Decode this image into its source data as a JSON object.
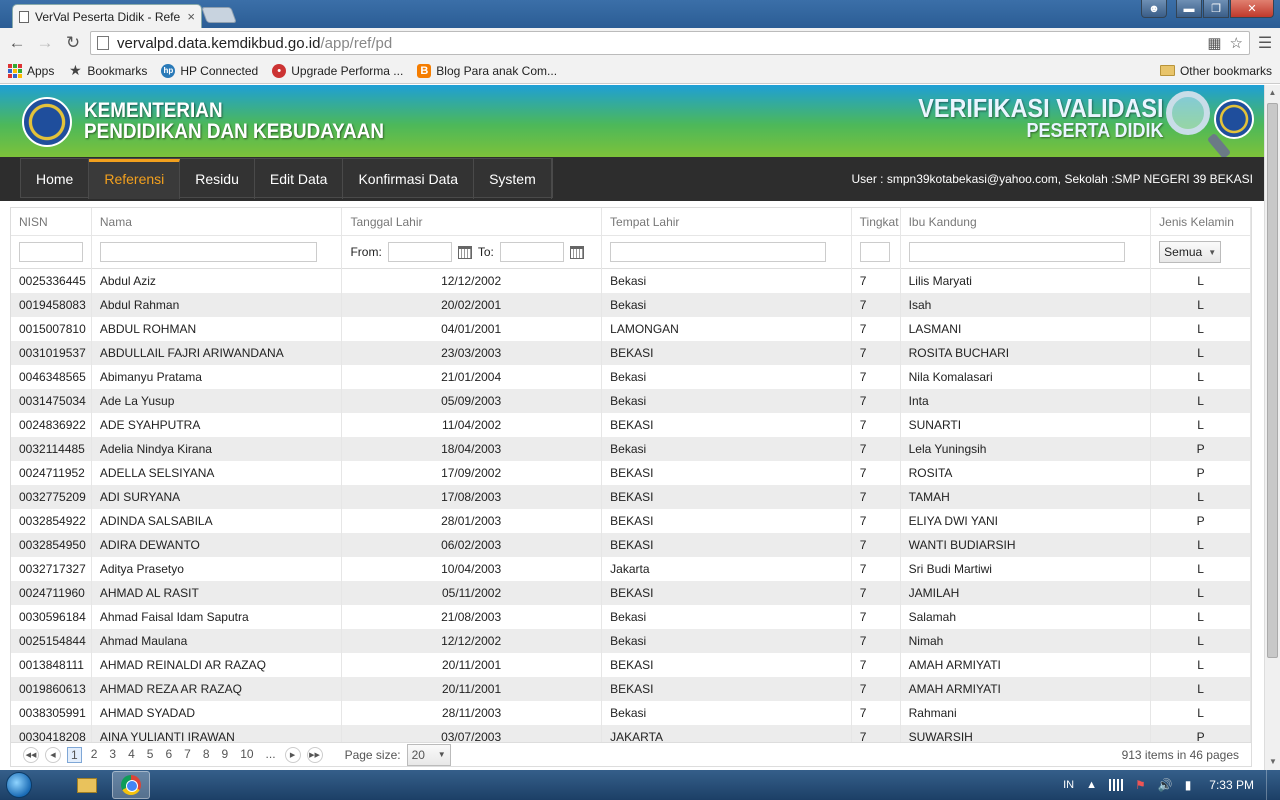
{
  "browser": {
    "tab_title": "VerVal Peserta Didik - Refe",
    "tab_close": "×",
    "url_host": "vervalpd.data.kemdikbud.go.id",
    "url_path": "/app/ref/pd",
    "bookmarks": [
      {
        "label": "Apps",
        "icon": "apps-icon"
      },
      {
        "label": "Bookmarks",
        "icon": "star-icon"
      },
      {
        "label": "HP Connected",
        "icon": "hp-icon"
      },
      {
        "label": "Upgrade Performa ...",
        "icon": "upgrade-icon"
      },
      {
        "label": "Blog Para anak Com...",
        "icon": "blogger-icon"
      }
    ],
    "other_bookmarks": "Other bookmarks"
  },
  "banner": {
    "left_line1": "KEMENTERIAN",
    "left_line2": "PENDIDIKAN DAN KEBUDAYAAN",
    "right_line1": "VERIFIKASI VALIDASI",
    "right_line2": "PESERTA DIDIK"
  },
  "nav": {
    "items": [
      "Home",
      "Referensi",
      "Residu",
      "Edit Data",
      "Konfirmasi Data",
      "System"
    ],
    "active": "Referensi",
    "user_info": "User : smpn39kotabekasi@yahoo.com, Sekolah :SMP NEGERI 39 BEKASI"
  },
  "grid": {
    "columns": [
      "NISN",
      "Nama",
      "Tanggal Lahir",
      "Tempat Lahir",
      "Tingkat",
      "Ibu Kandung",
      "Jenis Kelamin"
    ],
    "filter_from": "From:",
    "filter_to": "To:",
    "gender_filter": "Semua",
    "rows": [
      [
        "0025336445",
        "Abdul Aziz",
        "12/12/2002",
        "Bekasi",
        "7",
        "Lilis Maryati",
        "L"
      ],
      [
        "0019458083",
        "Abdul Rahman",
        "20/02/2001",
        "Bekasi",
        "7",
        "Isah",
        "L"
      ],
      [
        "0015007810",
        "ABDUL ROHMAN",
        "04/01/2001",
        "LAMONGAN",
        "7",
        "LASMANI",
        "L"
      ],
      [
        "0031019537",
        "ABDULLAIL FAJRI ARIWANDANA",
        "23/03/2003",
        "BEKASI",
        "7",
        "ROSITA BUCHARI",
        "L"
      ],
      [
        "0046348565",
        "Abimanyu Pratama",
        "21/01/2004",
        "Bekasi",
        "7",
        "Nila Komalasari",
        "L"
      ],
      [
        "0031475034",
        "Ade La Yusup",
        "05/09/2003",
        "Bekasi",
        "7",
        "Inta",
        "L"
      ],
      [
        "0024836922",
        "ADE SYAHPUTRA",
        "11/04/2002",
        "BEKASI",
        "7",
        "SUNARTI",
        "L"
      ],
      [
        "0032114485",
        "Adelia Nindya Kirana",
        "18/04/2003",
        "Bekasi",
        "7",
        "Lela Yuningsih",
        "P"
      ],
      [
        "0024711952",
        "ADELLA SELSIYANA",
        "17/09/2002",
        "BEKASI",
        "7",
        "ROSITA",
        "P"
      ],
      [
        "0032775209",
        "ADI SURYANA",
        "17/08/2003",
        "BEKASI",
        "7",
        "TAMAH",
        "L"
      ],
      [
        "0032854922",
        "ADINDA SALSABILA",
        "28/01/2003",
        "BEKASI",
        "7",
        "ELIYA DWI YANI",
        "P"
      ],
      [
        "0032854950",
        "ADIRA DEWANTO",
        "06/02/2003",
        "BEKASI",
        "7",
        "WANTI BUDIARSIH",
        "L"
      ],
      [
        "0032717327",
        "Aditya Prasetyo",
        "10/04/2003",
        "Jakarta",
        "7",
        "Sri Budi Martiwi",
        "L"
      ],
      [
        "0024711960",
        "AHMAD AL RASIT",
        "05/11/2002",
        "BEKASI",
        "7",
        "JAMILAH",
        "L"
      ],
      [
        "0030596184",
        "Ahmad Faisal Idam Saputra",
        "21/08/2003",
        "Bekasi",
        "7",
        "Salamah",
        "L"
      ],
      [
        "0025154844",
        "Ahmad Maulana",
        "12/12/2002",
        "Bekasi",
        "7",
        "Nimah",
        "L"
      ],
      [
        "0013848111",
        "AHMAD REINALDI AR RAZAQ",
        "20/11/2001",
        "BEKASI",
        "7",
        "AMAH ARMIYATI",
        "L"
      ],
      [
        "0019860613",
        "AHMAD REZA AR RAZAQ",
        "20/11/2001",
        "BEKASI",
        "7",
        "AMAH ARMIYATI",
        "L"
      ],
      [
        "0038305991",
        "AHMAD SYADAD",
        "28/11/2003",
        "Bekasi",
        "7",
        "Rahmani",
        "L"
      ],
      [
        "0030418208",
        "AINA YULIANTI IRAWAN",
        "03/07/2003",
        "JAKARTA",
        "7",
        "SUWARSIH",
        "P"
      ]
    ]
  },
  "pager": {
    "pages": [
      "1",
      "2",
      "3",
      "4",
      "5",
      "6",
      "7",
      "8",
      "9",
      "10",
      "..."
    ],
    "current": "1",
    "page_size_label": "Page size:",
    "page_size": "20",
    "total": "913 items in 46 pages"
  },
  "taskbar": {
    "lang": "IN",
    "time": "7:33 PM"
  }
}
